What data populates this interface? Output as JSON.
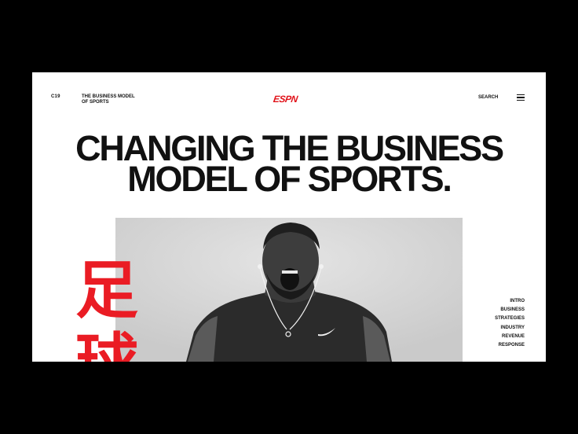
{
  "header": {
    "code": "C19",
    "tagline": "THE BUSINESS MODEL OF SPORTS",
    "logo_text": "ESPN",
    "search_label": "SEARCH",
    "menu_icon": "hamburger-menu-icon"
  },
  "hero": {
    "headline": "CHANGING THE BUSINESS MODEL OF SPORTS.",
    "kanji": "足球",
    "image": "athlete-shouting-photo"
  },
  "nav": {
    "items": [
      "INTRO",
      "BUSINESS",
      "STRATEGIES",
      "INDUSTRY",
      "REVENUE",
      "RESPONSE"
    ]
  },
  "colors": {
    "accent": "#e1141b",
    "background": "#000000",
    "panel": "#ffffff",
    "text": "#111111"
  }
}
